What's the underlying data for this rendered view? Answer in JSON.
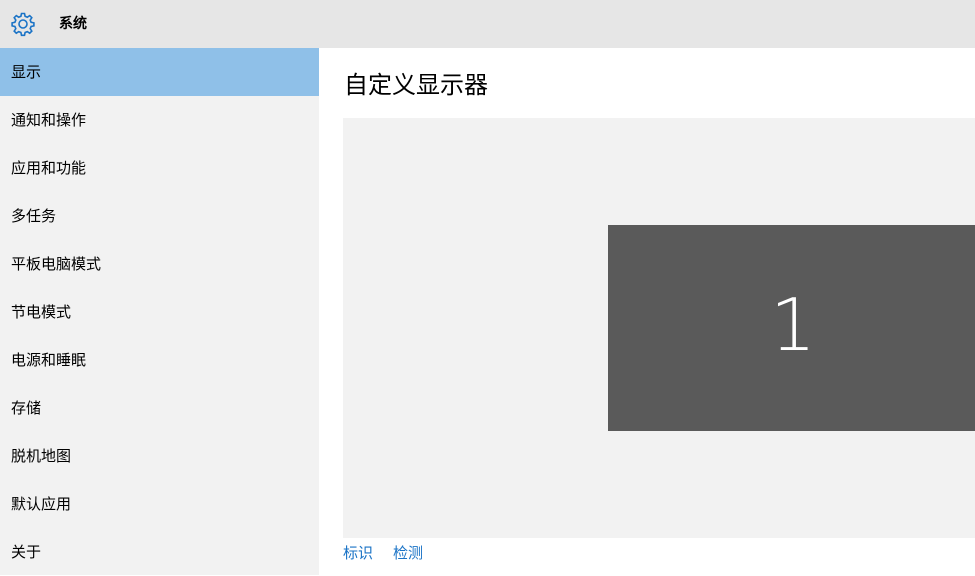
{
  "titlebar": {
    "icon": "gear-icon",
    "title": "系统"
  },
  "sidebar": {
    "items": [
      {
        "label": "显示",
        "selected": true
      },
      {
        "label": "通知和操作"
      },
      {
        "label": "应用和功能"
      },
      {
        "label": "多任务"
      },
      {
        "label": "平板电脑模式"
      },
      {
        "label": "节电模式"
      },
      {
        "label": "电源和睡眠"
      },
      {
        "label": "存储"
      },
      {
        "label": "脱机地图"
      },
      {
        "label": "默认应用"
      },
      {
        "label": "关于"
      }
    ]
  },
  "main": {
    "heading": "自定义显示器",
    "monitor_number": "1",
    "links": {
      "identify": "标识",
      "detect": "检测"
    }
  },
  "colors": {
    "accent": "#1a73c6",
    "selected_bg": "#8fc0e8",
    "monitor_bg": "#5a5a5a"
  }
}
